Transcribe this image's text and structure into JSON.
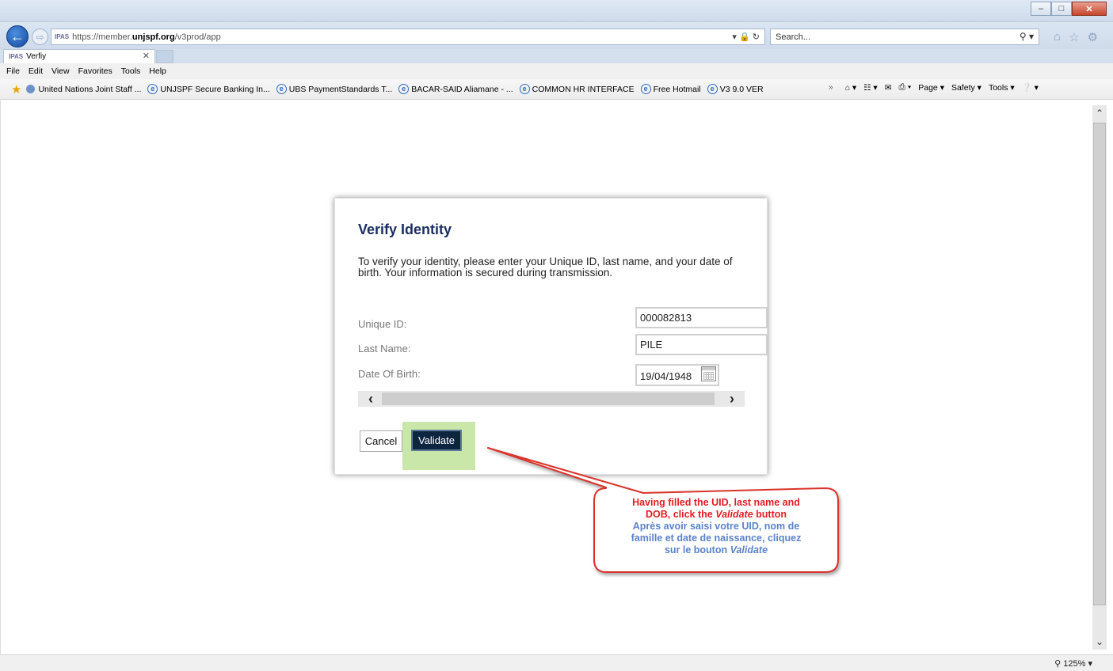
{
  "browser": {
    "site_tag": "IPAS",
    "url_prefix": "https://member.",
    "url_domain": "unjspf.org",
    "url_path": "/v3prod/app",
    "search_placeholder": "Search...",
    "tab_title": "Verfiy",
    "tab_site_tag": "IPAS",
    "menu": [
      "File",
      "Edit",
      "View",
      "Favorites",
      "Tools",
      "Help"
    ],
    "favorites": [
      "United Nations Joint Staff ...",
      "UNJSPF Secure Banking In...",
      "UBS PaymentStandards T...",
      "BACAR-SAID Aliamane - ...",
      "COMMON HR INTERFACE",
      "Free Hotmail",
      "V3 9.0 VER"
    ],
    "command_bar": {
      "page": "Page ▾",
      "safety": "Safety ▾",
      "tools": "Tools ▾"
    },
    "zoom": "125%"
  },
  "dialog": {
    "title": "Verify Identity",
    "description": "To verify your identity, please enter your Unique ID, last name, and your date of birth. Your information is secured during transmission.",
    "fields": {
      "unique_id": {
        "label": "Unique ID:",
        "value": "000082813"
      },
      "last_name": {
        "label": "Last Name:",
        "value": "PILE"
      },
      "dob": {
        "label": "Date Of Birth:",
        "value": "19/04/1948"
      }
    },
    "cancel_label": "Cancel",
    "validate_label": "Validate"
  },
  "callout": {
    "en_line1": "Having filled the UID, last name and",
    "en_line2_prefix": "DOB, click the ",
    "en_line2_em": "Validate",
    "en_line2_suffix": " button",
    "fr_line1": "Après avoir saisi votre UID, nom de",
    "fr_line2": "famille et date de naissance, cliquez",
    "fr_line3_prefix": "sur le bouton ",
    "fr_line3_em": "Validate",
    "colors": {
      "en": "#e51c23",
      "fr": "#5a82c9",
      "border": "#d9342b"
    }
  }
}
